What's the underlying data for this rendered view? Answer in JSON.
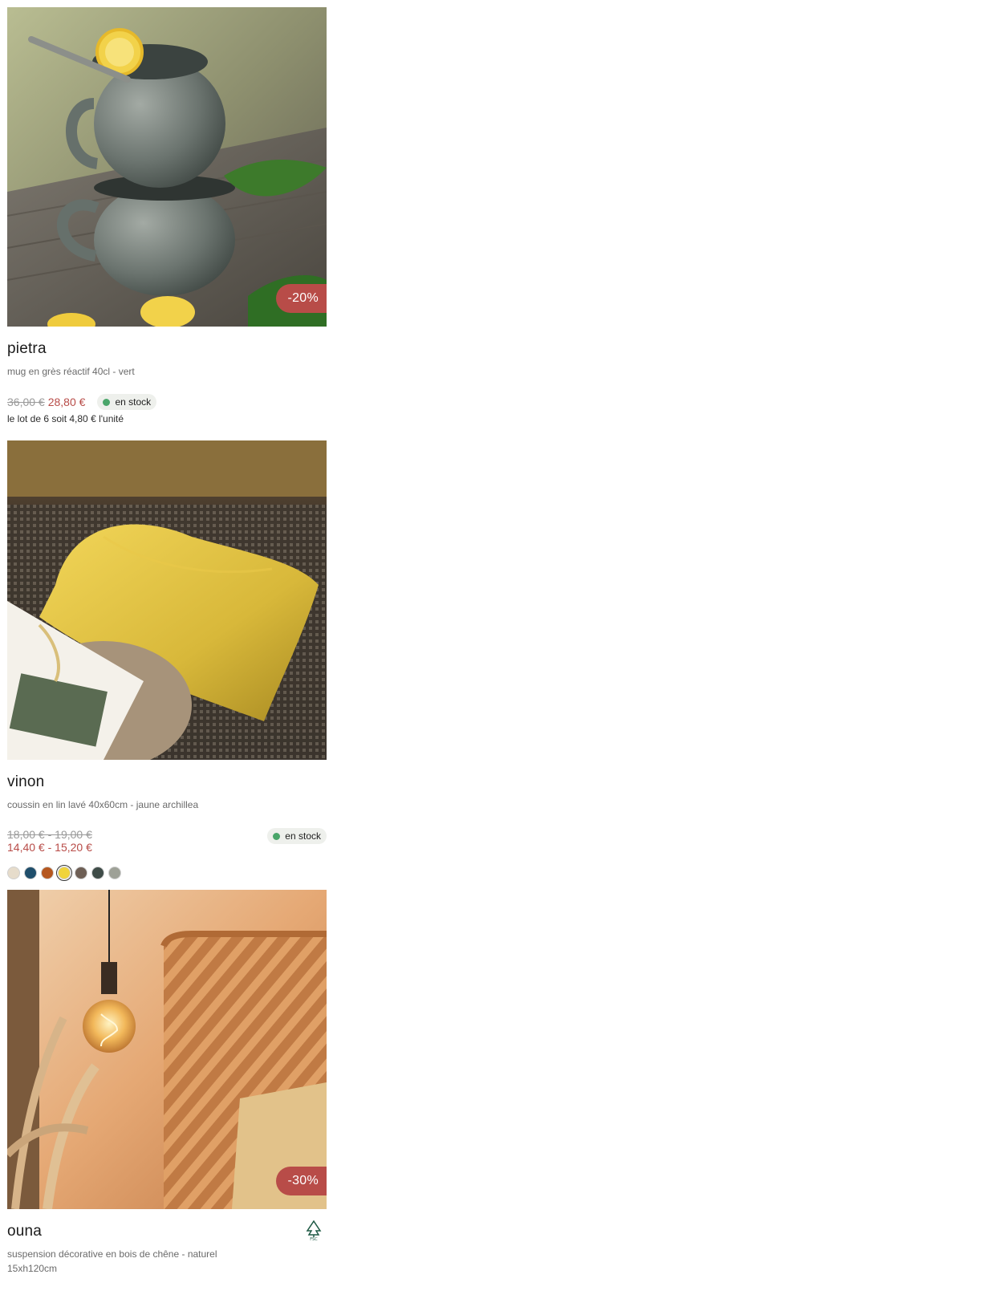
{
  "products": [
    {
      "name": "pietra",
      "description": "mug en grès réactif 40cl - vert",
      "badge": "-20%",
      "old_price": "36,00 €",
      "new_price": "28,80 €",
      "stock": "en stock",
      "lot_info": "le lot de 6 soit 4,80 € l'unité"
    },
    {
      "name": "vinon",
      "description": "coussin en lin lavé 40x60cm - jaune archillea",
      "old_price": "18,00 € - 19,00 €",
      "new_price": "14,40 € - 15,20 €",
      "stock": "en stock",
      "swatches": [
        "#e6dccb",
        "#1f4e6b",
        "#b5571f",
        "#f0d43a",
        "#6e5f55",
        "#3f4c48",
        "#9ea197"
      ],
      "selected_swatch": 3
    },
    {
      "name": "ouna",
      "description": "suspension décorative en bois de chêne - naturel",
      "dimensions": "15xh120cm",
      "badge": "-30%",
      "certification_icon": "fsc-tree-icon"
    }
  ],
  "colors": {
    "promo": "#b84c48",
    "stock_dot": "#4aa66a",
    "stock_bg": "#eef0ec"
  }
}
